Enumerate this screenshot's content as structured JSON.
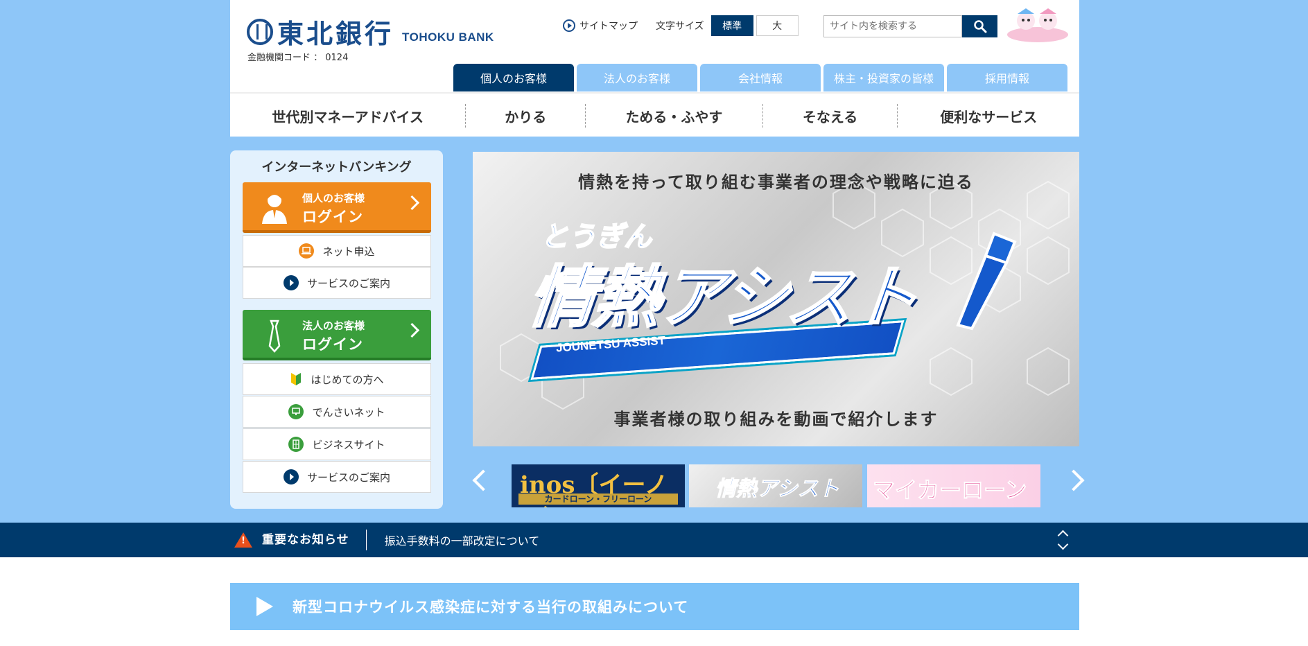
{
  "header": {
    "logo_jp": "東北銀行",
    "logo_en": "TOHOKU BANK",
    "bank_code": "金融機関コード ： 0124",
    "sitemap": "サイトマップ",
    "font_size_label": "文字サイズ",
    "font_size_standard": "標準",
    "font_size_large": "大",
    "search_placeholder": "サイト内を検索する"
  },
  "tabs": [
    {
      "label": "個人のお客様",
      "active": true
    },
    {
      "label": "法人のお客様",
      "active": false
    },
    {
      "label": "会社情報",
      "active": false
    },
    {
      "label": "株主・投資家の皆様",
      "active": false
    },
    {
      "label": "採用情報",
      "active": false
    }
  ],
  "global_nav": [
    "世代別マネーアドバイス",
    "かりる",
    "ためる・ふやす",
    "そなえる",
    "便利なサービス"
  ],
  "ib": {
    "title": "インターネットバンキング",
    "personal": {
      "sub": "個人のお客様",
      "main": "ログイン"
    },
    "personal_links": [
      "ネット申込",
      "サービスのご案内"
    ],
    "corporate": {
      "sub": "法人のお客様",
      "main": "ログイン"
    },
    "corporate_links": [
      "はじめての方へ",
      "でんさいネット",
      "ビジネスサイト",
      "サービスのご案内"
    ]
  },
  "hero": {
    "top": "情熱を持って取り組む事業者の理念や戦略に迫る",
    "brand_small": "とうぎん",
    "brand_big": "情熱アシスト",
    "brand_en": "JOUNETSU ASSIST",
    "bottom": "事業者様の取り組みを動画で紹介します"
  },
  "carousel": {
    "thumb1_main": "inos〔イーノス〕",
    "thumb1_bar": "カードローン・フリーローン",
    "thumb2_main": "情熱アシスト",
    "thumb3_main": "マイカーローン"
  },
  "notice": {
    "label": "重要なお知らせ",
    "text": "振込手数料の一部改定について"
  },
  "covid": {
    "text": "新型コロナウイルス感染症に対する当行の取組みについて"
  },
  "colors": {
    "navy": "#003a6c",
    "light_blue": "#8ec6f8",
    "orange": "#f08a1c",
    "green": "#3a9e3c"
  }
}
